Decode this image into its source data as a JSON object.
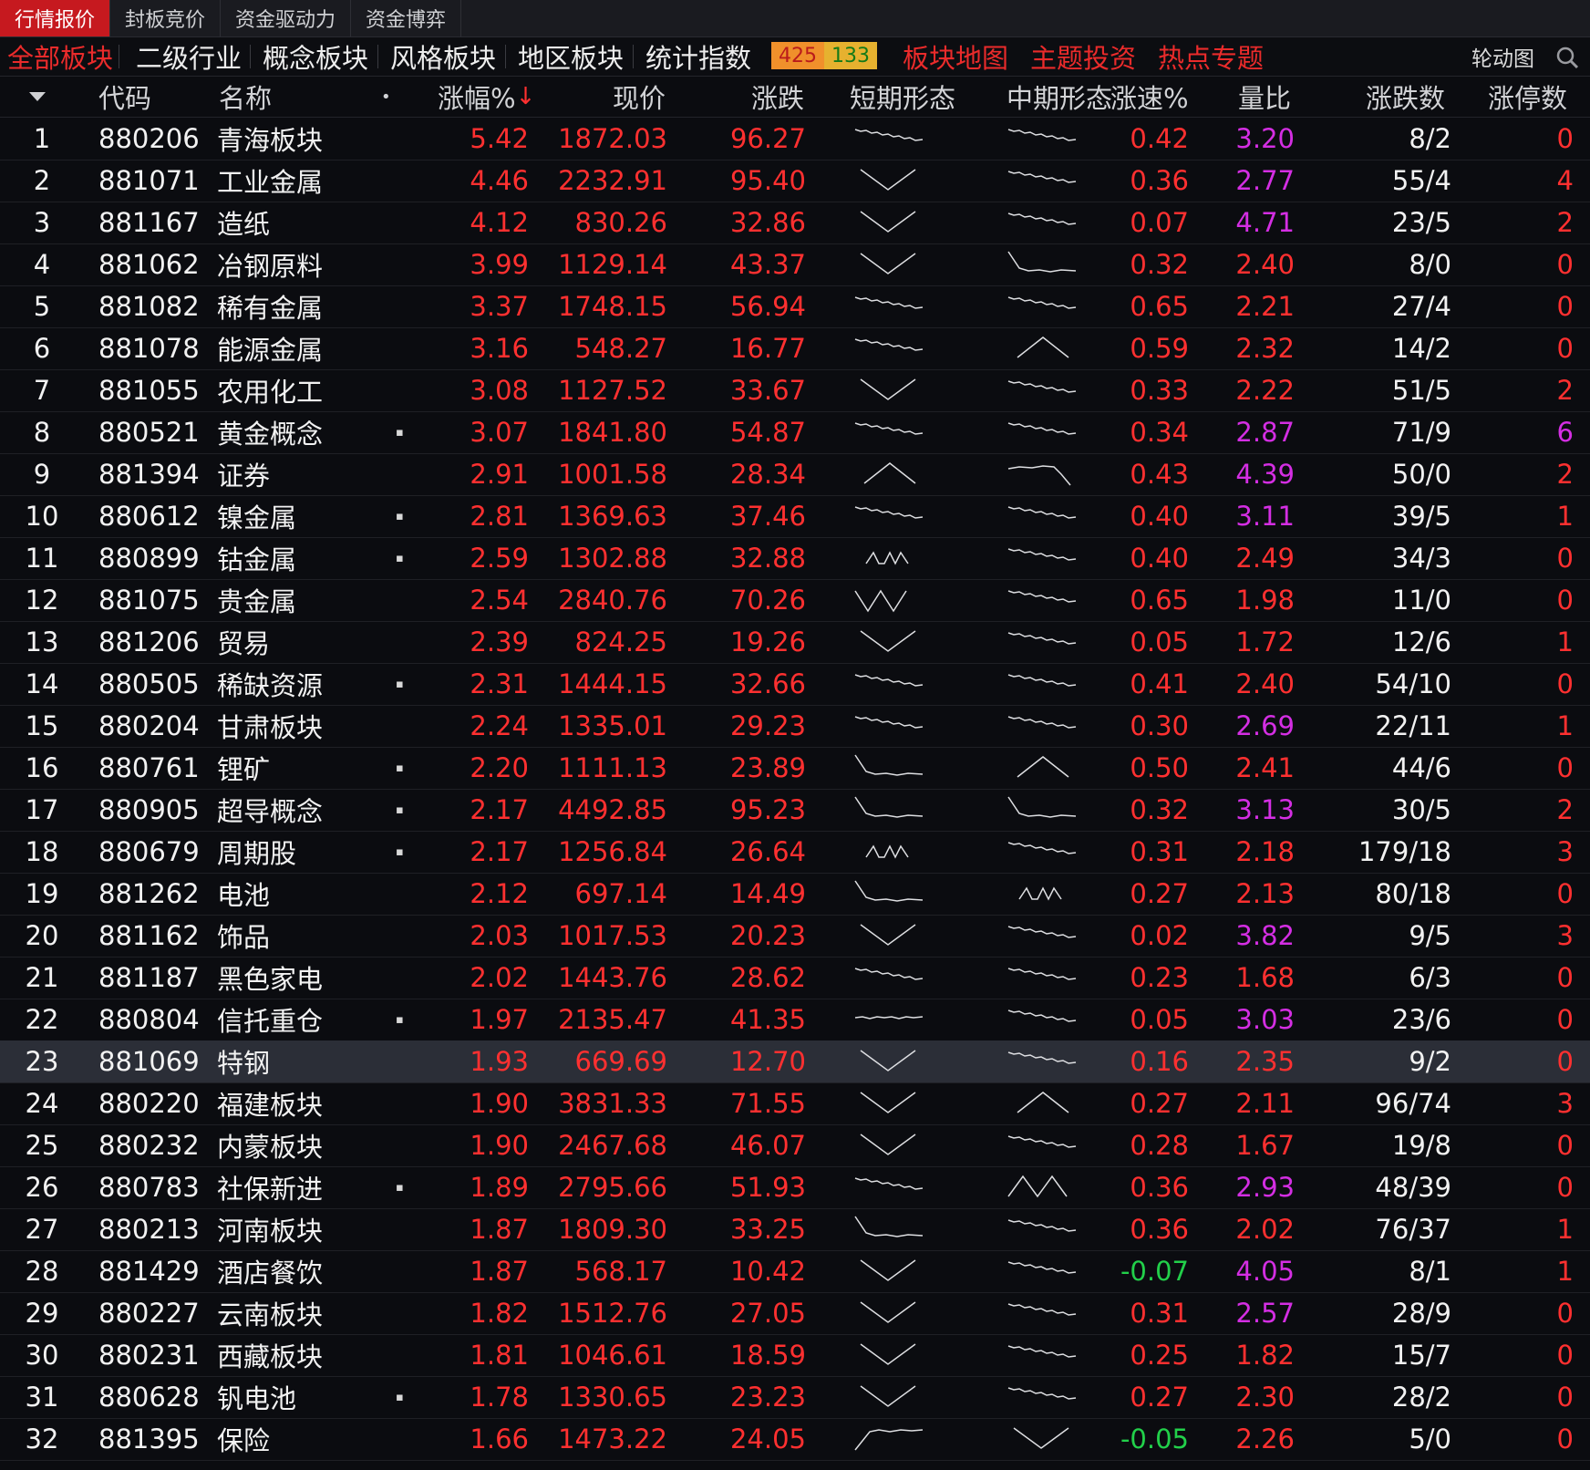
{
  "top_tabs": [
    "行情报价",
    "封板竞价",
    "资金驱动力",
    "资金博弈"
  ],
  "sector_tabs": [
    "全部板块",
    "二级行业",
    "概念板块",
    "风格板块",
    "地区板块",
    "统计指数"
  ],
  "breadth": {
    "up": "425",
    "down": "133"
  },
  "red_links": [
    "板块地图",
    "主题投资",
    "热点专题"
  ],
  "rotation_label": "轮动图",
  "columns": {
    "code": "代码",
    "name": "名称",
    "dot": "•",
    "pct": "涨幅%",
    "sort_arrow": "↓",
    "price": "现价",
    "change": "涨跌",
    "short": "短期形态",
    "mid": "中期形态",
    "speed": "涨速%",
    "vol_ratio": "量比",
    "updown": "涨跌数",
    "limit": "涨停数"
  },
  "colors": {
    "up": "#ff3030",
    "down": "#22d04a",
    "purple": "#d42ee3",
    "white": "#f2f2f2"
  },
  "rows": [
    {
      "n": "1",
      "code": "880206",
      "name": "青海板块",
      "mark": "",
      "pct": "5.42",
      "price": "1872.03",
      "chg": "96.27",
      "short": "down",
      "mid": "down",
      "speed": "0.42",
      "speed_c": "red",
      "vr": "3.20",
      "vr_c": "pur",
      "ud": "8/2",
      "lu": "0",
      "lu_c": "red"
    },
    {
      "n": "2",
      "code": "881071",
      "name": "工业金属",
      "mark": "",
      "pct": "4.46",
      "price": "2232.91",
      "chg": "95.40",
      "short": "v",
      "mid": "down",
      "speed": "0.36",
      "speed_c": "red",
      "vr": "2.77",
      "vr_c": "pur",
      "ud": "55/4",
      "lu": "4",
      "lu_c": "red"
    },
    {
      "n": "3",
      "code": "881167",
      "name": "造纸",
      "mark": "",
      "pct": "4.12",
      "price": "830.26",
      "chg": "32.86",
      "short": "v",
      "mid": "down",
      "speed": "0.07",
      "speed_c": "red",
      "vr": "4.71",
      "vr_c": "pur",
      "ud": "23/5",
      "lu": "2",
      "lu_c": "red"
    },
    {
      "n": "4",
      "code": "881062",
      "name": "冶钢原料",
      "mark": "",
      "pct": "3.99",
      "price": "1129.14",
      "chg": "43.37",
      "short": "v",
      "mid": "dropflat",
      "speed": "0.32",
      "speed_c": "red",
      "vr": "2.40",
      "vr_c": "red",
      "ud": "8/0",
      "lu": "0",
      "lu_c": "red"
    },
    {
      "n": "5",
      "code": "881082",
      "name": "稀有金属",
      "mark": "",
      "pct": "3.37",
      "price": "1748.15",
      "chg": "56.94",
      "short": "down",
      "mid": "down",
      "speed": "0.65",
      "speed_c": "red",
      "vr": "2.21",
      "vr_c": "red",
      "ud": "27/4",
      "lu": "0",
      "lu_c": "red"
    },
    {
      "n": "6",
      "code": "881078",
      "name": "能源金属",
      "mark": "",
      "pct": "3.16",
      "price": "548.27",
      "chg": "16.77",
      "short": "down",
      "mid": "peak",
      "speed": "0.59",
      "speed_c": "red",
      "vr": "2.32",
      "vr_c": "red",
      "ud": "14/2",
      "lu": "0",
      "lu_c": "red"
    },
    {
      "n": "7",
      "code": "881055",
      "name": "农用化工",
      "mark": "",
      "pct": "3.08",
      "price": "1127.52",
      "chg": "33.67",
      "short": "v",
      "mid": "down",
      "speed": "0.33",
      "speed_c": "red",
      "vr": "2.22",
      "vr_c": "red",
      "ud": "51/5",
      "lu": "2",
      "lu_c": "red"
    },
    {
      "n": "8",
      "code": "880521",
      "name": "黄金概念",
      "mark": "▪",
      "pct": "3.07",
      "price": "1841.80",
      "chg": "54.87",
      "short": "down",
      "mid": "down",
      "speed": "0.34",
      "speed_c": "red",
      "vr": "2.87",
      "vr_c": "pur",
      "ud": "71/9",
      "lu": "6",
      "lu_c": "pur"
    },
    {
      "n": "9",
      "code": "881394",
      "name": "证券",
      "mark": "",
      "pct": "2.91",
      "price": "1001.58",
      "chg": "28.34",
      "short": "peak",
      "mid": "flatdrop",
      "speed": "0.43",
      "speed_c": "red",
      "vr": "4.39",
      "vr_c": "pur",
      "ud": "50/0",
      "lu": "2",
      "lu_c": "red"
    },
    {
      "n": "10",
      "code": "880612",
      "name": "镍金属",
      "mark": "▪",
      "pct": "2.81",
      "price": "1369.63",
      "chg": "37.46",
      "short": "down",
      "mid": "down",
      "speed": "0.40",
      "speed_c": "red",
      "vr": "3.11",
      "vr_c": "pur",
      "ud": "39/5",
      "lu": "1",
      "lu_c": "red"
    },
    {
      "n": "11",
      "code": "880899",
      "name": "钴金属",
      "mark": "▪",
      "pct": "2.59",
      "price": "1302.88",
      "chg": "32.88",
      "short": "nva",
      "mid": "down",
      "speed": "0.40",
      "speed_c": "red",
      "vr": "2.49",
      "vr_c": "red",
      "ud": "34/3",
      "lu": "0",
      "lu_c": "red"
    },
    {
      "n": "12",
      "code": "881075",
      "name": "贵金属",
      "mark": "",
      "pct": "2.54",
      "price": "2840.76",
      "chg": "70.26",
      "short": "w",
      "mid": "down",
      "speed": "0.65",
      "speed_c": "red",
      "vr": "1.98",
      "vr_c": "red",
      "ud": "11/0",
      "lu": "0",
      "lu_c": "red"
    },
    {
      "n": "13",
      "code": "881206",
      "name": "贸易",
      "mark": "",
      "pct": "2.39",
      "price": "824.25",
      "chg": "19.26",
      "short": "v",
      "mid": "down",
      "speed": "0.05",
      "speed_c": "red",
      "vr": "1.72",
      "vr_c": "red",
      "ud": "12/6",
      "lu": "1",
      "lu_c": "red"
    },
    {
      "n": "14",
      "code": "880505",
      "name": "稀缺资源",
      "mark": "▪",
      "pct": "2.31",
      "price": "1444.15",
      "chg": "32.66",
      "short": "down",
      "mid": "down",
      "speed": "0.41",
      "speed_c": "red",
      "vr": "2.40",
      "vr_c": "red",
      "ud": "54/10",
      "lu": "0",
      "lu_c": "red"
    },
    {
      "n": "15",
      "code": "880204",
      "name": "甘肃板块",
      "mark": "",
      "pct": "2.24",
      "price": "1335.01",
      "chg": "29.23",
      "short": "down",
      "mid": "down",
      "speed": "0.30",
      "speed_c": "red",
      "vr": "2.69",
      "vr_c": "pur",
      "ud": "22/11",
      "lu": "1",
      "lu_c": "red"
    },
    {
      "n": "16",
      "code": "880761",
      "name": "锂矿",
      "mark": "▪",
      "pct": "2.20",
      "price": "1111.13",
      "chg": "23.89",
      "short": "dropflat",
      "mid": "peak",
      "speed": "0.50",
      "speed_c": "red",
      "vr": "2.41",
      "vr_c": "red",
      "ud": "44/6",
      "lu": "0",
      "lu_c": "red"
    },
    {
      "n": "17",
      "code": "880905",
      "name": "超导概念",
      "mark": "▪",
      "pct": "2.17",
      "price": "4492.85",
      "chg": "95.23",
      "short": "dropflat",
      "mid": "dropflat",
      "speed": "0.32",
      "speed_c": "red",
      "vr": "3.13",
      "vr_c": "pur",
      "ud": "30/5",
      "lu": "2",
      "lu_c": "red"
    },
    {
      "n": "18",
      "code": "880679",
      "name": "周期股",
      "mark": "▪",
      "pct": "2.17",
      "price": "1256.84",
      "chg": "26.64",
      "short": "nva",
      "mid": "down",
      "speed": "0.31",
      "speed_c": "red",
      "vr": "2.18",
      "vr_c": "red",
      "ud": "179/18",
      "lu": "3",
      "lu_c": "red"
    },
    {
      "n": "19",
      "code": "881262",
      "name": "电池",
      "mark": "",
      "pct": "2.12",
      "price": "697.14",
      "chg": "14.49",
      "short": "dropflat",
      "mid": "nva",
      "speed": "0.27",
      "speed_c": "red",
      "vr": "2.13",
      "vr_c": "red",
      "ud": "80/18",
      "lu": "0",
      "lu_c": "red"
    },
    {
      "n": "20",
      "code": "881162",
      "name": "饰品",
      "mark": "",
      "pct": "2.03",
      "price": "1017.53",
      "chg": "20.23",
      "short": "v",
      "mid": "down",
      "speed": "0.02",
      "speed_c": "red",
      "vr": "3.82",
      "vr_c": "pur",
      "ud": "9/5",
      "lu": "3",
      "lu_c": "red"
    },
    {
      "n": "21",
      "code": "881187",
      "name": "黑色家电",
      "mark": "",
      "pct": "2.02",
      "price": "1443.76",
      "chg": "28.62",
      "short": "down",
      "mid": "down",
      "speed": "0.23",
      "speed_c": "red",
      "vr": "1.68",
      "vr_c": "red",
      "ud": "6/3",
      "lu": "0",
      "lu_c": "red"
    },
    {
      "n": "22",
      "code": "880804",
      "name": "信托重仓",
      "mark": "▪",
      "pct": "1.97",
      "price": "2135.47",
      "chg": "41.35",
      "short": "flat",
      "mid": "down",
      "speed": "0.05",
      "speed_c": "red",
      "vr": "3.03",
      "vr_c": "pur",
      "ud": "23/6",
      "lu": "0",
      "lu_c": "red"
    },
    {
      "n": "23",
      "code": "881069",
      "name": "特钢",
      "mark": "",
      "pct": "1.93",
      "price": "669.69",
      "chg": "12.70",
      "short": "v",
      "mid": "down",
      "speed": "0.16",
      "speed_c": "red",
      "vr": "2.35",
      "vr_c": "red",
      "ud": "9/2",
      "lu": "0",
      "lu_c": "red",
      "sel": true
    },
    {
      "n": "24",
      "code": "880220",
      "name": "福建板块",
      "mark": "",
      "pct": "1.90",
      "price": "3831.33",
      "chg": "71.55",
      "short": "v",
      "mid": "peak",
      "speed": "0.27",
      "speed_c": "red",
      "vr": "2.11",
      "vr_c": "red",
      "ud": "96/74",
      "lu": "3",
      "lu_c": "red"
    },
    {
      "n": "25",
      "code": "880232",
      "name": "内蒙板块",
      "mark": "",
      "pct": "1.90",
      "price": "2467.68",
      "chg": "46.07",
      "short": "v",
      "mid": "down",
      "speed": "0.28",
      "speed_c": "red",
      "vr": "1.67",
      "vr_c": "red",
      "ud": "19/8",
      "lu": "0",
      "lu_c": "red"
    },
    {
      "n": "26",
      "code": "880783",
      "name": "社保新进",
      "mark": "▪",
      "pct": "1.89",
      "price": "2795.66",
      "chg": "51.93",
      "short": "down",
      "mid": "m",
      "speed": "0.36",
      "speed_c": "red",
      "vr": "2.93",
      "vr_c": "pur",
      "ud": "48/39",
      "lu": "0",
      "lu_c": "red"
    },
    {
      "n": "27",
      "code": "880213",
      "name": "河南板块",
      "mark": "",
      "pct": "1.87",
      "price": "1809.30",
      "chg": "33.25",
      "short": "dropflat",
      "mid": "down",
      "speed": "0.36",
      "speed_c": "red",
      "vr": "2.02",
      "vr_c": "red",
      "ud": "76/37",
      "lu": "1",
      "lu_c": "red"
    },
    {
      "n": "28",
      "code": "881429",
      "name": "酒店餐饮",
      "mark": "",
      "pct": "1.87",
      "price": "568.17",
      "chg": "10.42",
      "short": "v",
      "mid": "down",
      "speed": "0.07",
      "speed_c": "grn",
      "speed_pre": "-",
      "vr": "4.05",
      "vr_c": "pur",
      "ud": "8/1",
      "lu": "1",
      "lu_c": "red"
    },
    {
      "n": "29",
      "code": "880227",
      "name": "云南板块",
      "mark": "",
      "pct": "1.82",
      "price": "1512.76",
      "chg": "27.05",
      "short": "v",
      "mid": "down",
      "speed": "0.31",
      "speed_c": "red",
      "vr": "2.57",
      "vr_c": "pur",
      "ud": "28/9",
      "lu": "0",
      "lu_c": "red"
    },
    {
      "n": "30",
      "code": "880231",
      "name": "西藏板块",
      "mark": "",
      "pct": "1.81",
      "price": "1046.61",
      "chg": "18.59",
      "short": "v",
      "mid": "down",
      "speed": "0.25",
      "speed_c": "red",
      "vr": "1.82",
      "vr_c": "red",
      "ud": "15/7",
      "lu": "0",
      "lu_c": "red"
    },
    {
      "n": "31",
      "code": "880628",
      "name": "钒电池",
      "mark": "▪",
      "pct": "1.78",
      "price": "1330.65",
      "chg": "23.23",
      "short": "v",
      "mid": "down",
      "speed": "0.27",
      "speed_c": "red",
      "vr": "2.30",
      "vr_c": "red",
      "ud": "28/2",
      "lu": "0",
      "lu_c": "red"
    },
    {
      "n": "32",
      "code": "881395",
      "name": "保险",
      "mark": "",
      "pct": "1.66",
      "price": "1473.22",
      "chg": "24.05",
      "short": "riseflat",
      "mid": "v",
      "speed": "0.05",
      "speed_c": "grn",
      "speed_pre": "-",
      "vr": "2.26",
      "vr_c": "red",
      "ud": "5/0",
      "lu": "0",
      "lu_c": "red"
    }
  ]
}
